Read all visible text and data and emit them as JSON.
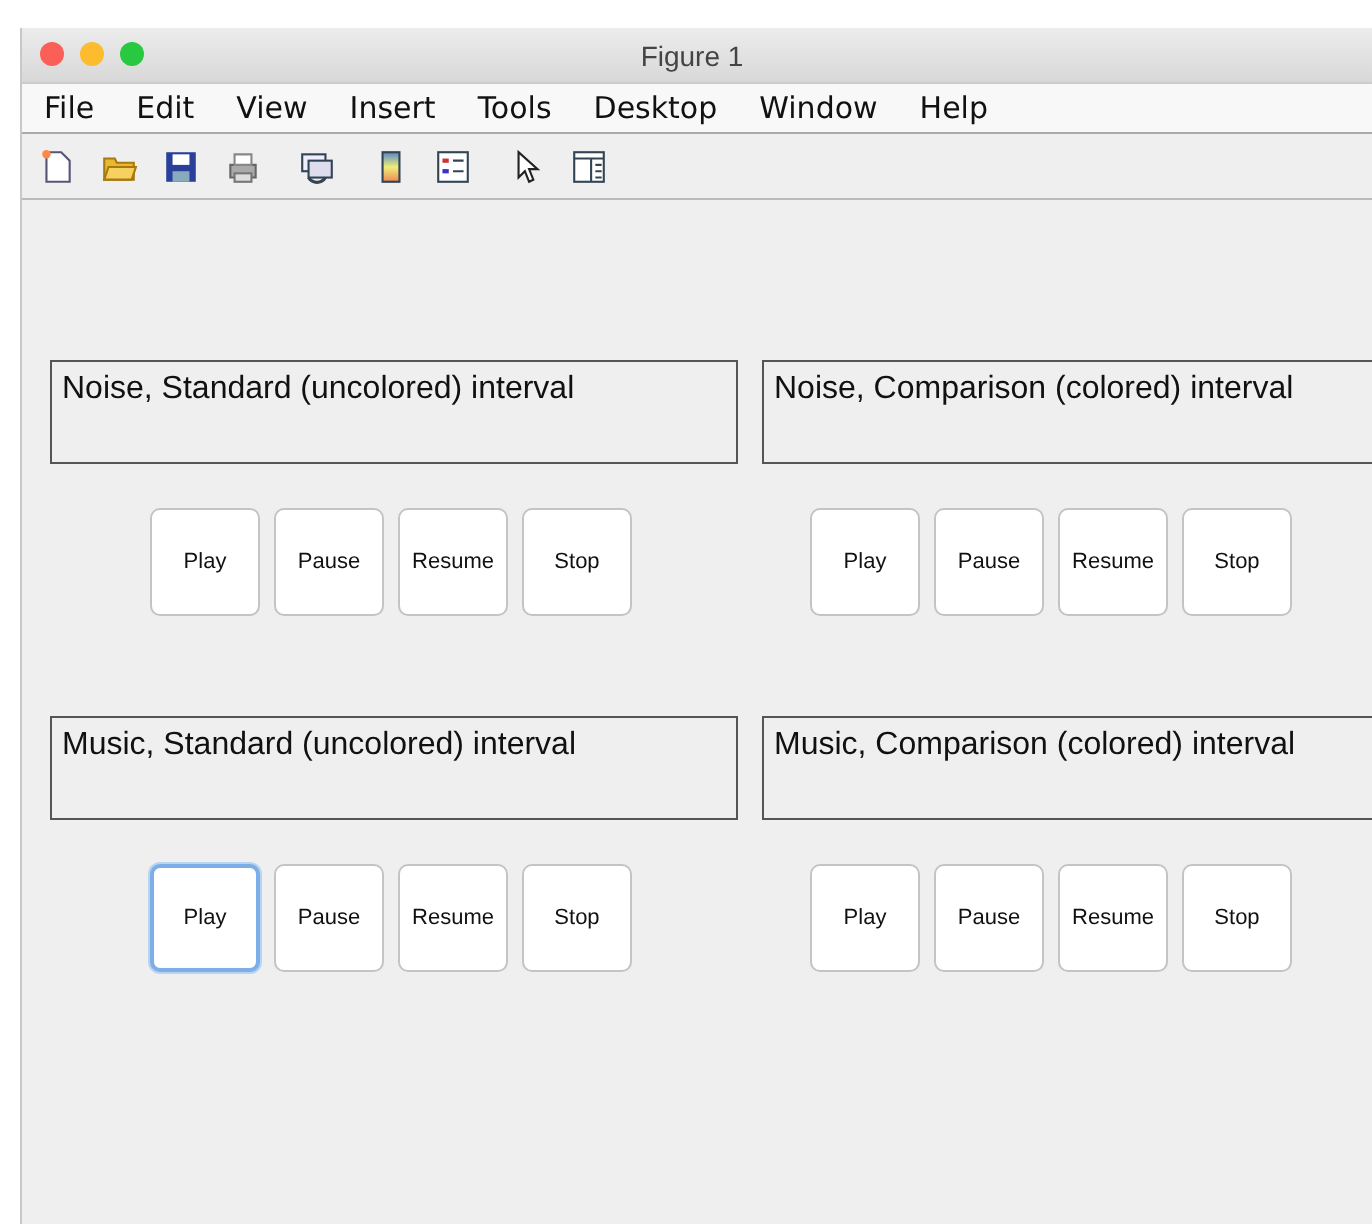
{
  "window": {
    "title": "Figure 1"
  },
  "menu": [
    "File",
    "Edit",
    "View",
    "Insert",
    "Tools",
    "Desktop",
    "Window",
    "Help"
  ],
  "panels": [
    {
      "label": "Noise, Standard (uncolored) interval",
      "buttons": [
        {
          "label": "Play",
          "focused": false
        },
        {
          "label": "Pause",
          "focused": false
        },
        {
          "label": "Resume",
          "focused": false
        },
        {
          "label": "Stop",
          "focused": false
        }
      ]
    },
    {
      "label": "Noise, Comparison (colored) interval",
      "buttons": [
        {
          "label": "Play",
          "focused": false
        },
        {
          "label": "Pause",
          "focused": false
        },
        {
          "label": "Resume",
          "focused": false
        },
        {
          "label": "Stop",
          "focused": false
        }
      ]
    },
    {
      "label": "Music, Standard (uncolored) interval",
      "buttons": [
        {
          "label": "Play",
          "focused": true
        },
        {
          "label": "Pause",
          "focused": false
        },
        {
          "label": "Resume",
          "focused": false
        },
        {
          "label": "Stop",
          "focused": false
        }
      ]
    },
    {
      "label": "Music, Comparison (colored) interval",
      "buttons": [
        {
          "label": "Play",
          "focused": false
        },
        {
          "label": "Pause",
          "focused": false
        },
        {
          "label": "Resume",
          "focused": false
        },
        {
          "label": "Stop",
          "focused": false
        }
      ]
    }
  ]
}
